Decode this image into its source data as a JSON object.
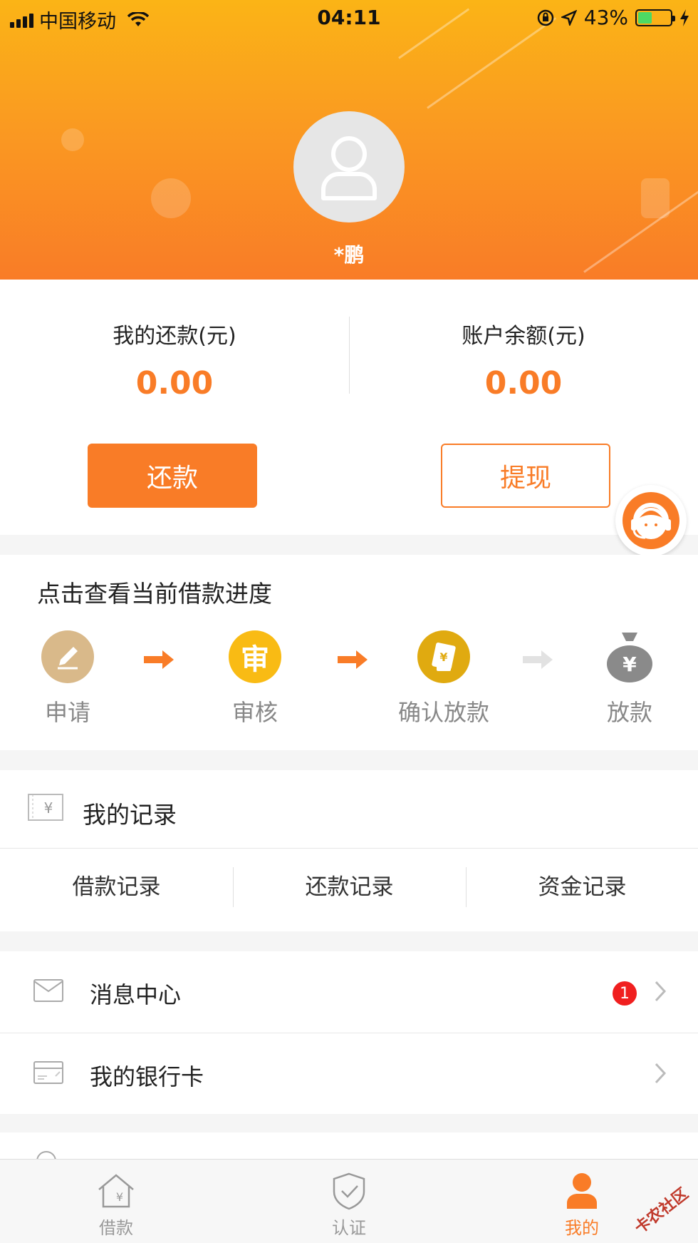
{
  "status_bar": {
    "carrier": "中国移动",
    "time": "04:11",
    "battery_percent": "43%",
    "battery_level": 0.43,
    "icons": [
      "signal-icon",
      "wifi-icon",
      "orientation-lock-icon",
      "location-icon",
      "battery-icon",
      "charging-icon"
    ]
  },
  "profile": {
    "name": "*鹏"
  },
  "balance": {
    "repay_label": "我的还款(元)",
    "repay_value": "0.00",
    "account_label": "账户余额(元)",
    "account_value": "0.00",
    "repay_button": "还款",
    "withdraw_button": "提现"
  },
  "progress": {
    "title": "点击查看当前借款进度",
    "steps": [
      {
        "label": "申请",
        "icon": "pencil-icon"
      },
      {
        "label": "审核",
        "icon": "review-icon",
        "glyph": "审"
      },
      {
        "label": "确认放款",
        "icon": "confirm-loan-icon"
      },
      {
        "label": "放款",
        "icon": "money-bag-icon",
        "glyph": "¥"
      }
    ]
  },
  "records": {
    "title": "我的记录",
    "tabs": [
      "借款记录",
      "还款记录",
      "资金记录"
    ]
  },
  "menu": {
    "items": [
      {
        "label": "消息中心",
        "icon": "mail-icon",
        "badge": "1"
      },
      {
        "label": "我的银行卡",
        "icon": "bank-card-icon"
      }
    ]
  },
  "tabbar": {
    "tabs": [
      {
        "label": "借款",
        "icon": "home-yen-icon"
      },
      {
        "label": "认证",
        "icon": "shield-check-icon"
      },
      {
        "label": "我的",
        "icon": "user-icon",
        "active": true
      }
    ]
  },
  "watermark": "卡农社区",
  "colors": {
    "accent": "#f97c27",
    "header_top": "#fbb416",
    "badge": "#f01f1f"
  }
}
